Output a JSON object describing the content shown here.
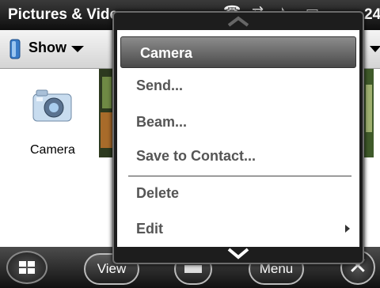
{
  "titlebar": {
    "title": "Pictures & Videos",
    "clock": "24",
    "icons": [
      "phone-icon",
      "signal-icon",
      "sound-icon",
      "battery-icon"
    ]
  },
  "toolbar": {
    "show_label": "Show"
  },
  "content": {
    "items": [
      {
        "label": "Camera",
        "icon": "camera-icon"
      }
    ]
  },
  "menu": {
    "items": [
      {
        "label": "Camera",
        "selected": true
      },
      {
        "label": "Send..."
      },
      {
        "label": "Beam..."
      },
      {
        "label": "Save to Contact..."
      },
      {
        "label": "Delete"
      },
      {
        "label": "Edit",
        "has_submenu": true
      }
    ]
  },
  "taskbar": {
    "left_soft": "View",
    "right_soft": "Menu"
  }
}
